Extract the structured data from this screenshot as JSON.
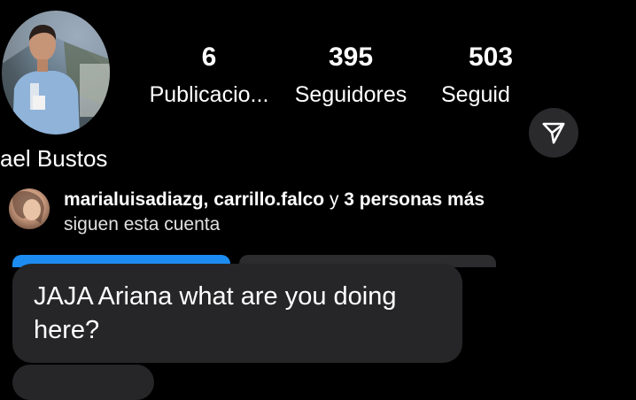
{
  "profile": {
    "name": "ael Bustos",
    "avatar_icon": "profile-photo"
  },
  "stats": [
    {
      "value": "6",
      "label": "Publicacio..."
    },
    {
      "value": "395",
      "label": "Seguidores"
    },
    {
      "value": "503",
      "label": "Seguid"
    }
  ],
  "share_icon": "paper-plane-icon",
  "followed_by": {
    "names": "marialuisadiazg, carrillo.falco",
    "connector": " y ",
    "others": "3 personas más",
    "line2": "siguen esta cuenta"
  },
  "colors": {
    "background": "#000000",
    "follow_button": "#1d8cf0",
    "secondary_button": "#2c2c2e",
    "bubble": "#262628"
  },
  "message": {
    "text": "JAJA Ariana what are you doing here?"
  }
}
